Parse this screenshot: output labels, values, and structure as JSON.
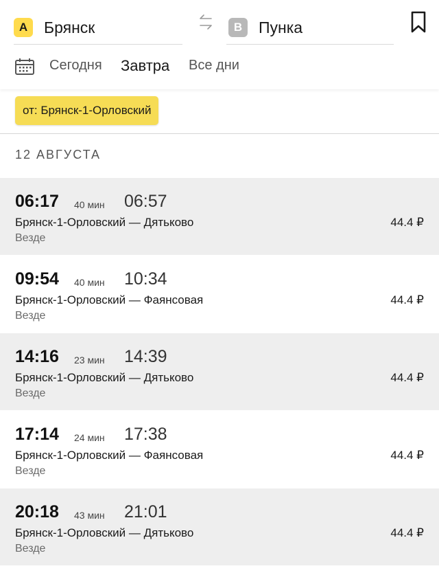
{
  "search": {
    "from": {
      "badge": "A",
      "city": "Брянск"
    },
    "to": {
      "badge": "B",
      "city": "Пунка"
    }
  },
  "days": {
    "today": "Сегодня",
    "tomorrow": "Завтра",
    "all": "Все дни",
    "selected": "tomorrow"
  },
  "station_filter": "от: Брянск-1-Орловский",
  "date_header": "12 АВГУСТА",
  "trips": [
    {
      "dep": "06:17",
      "duration": "40 мин",
      "arr": "06:57",
      "route": "Брянск-1-Орловский — Дятьково",
      "stops": "Везде",
      "price": "44.4 ₽"
    },
    {
      "dep": "09:54",
      "duration": "40 мин",
      "arr": "10:34",
      "route": "Брянск-1-Орловский — Фаянсовая",
      "stops": "Везде",
      "price": "44.4 ₽"
    },
    {
      "dep": "14:16",
      "duration": "23 мин",
      "arr": "14:39",
      "route": "Брянск-1-Орловский — Дятьково",
      "stops": "Везде",
      "price": "44.4 ₽"
    },
    {
      "dep": "17:14",
      "duration": "24 мин",
      "arr": "17:38",
      "route": "Брянск-1-Орловский — Фаянсовая",
      "stops": "Везде",
      "price": "44.4 ₽"
    },
    {
      "dep": "20:18",
      "duration": "43 мин",
      "arr": "21:01",
      "route": "Брянск-1-Орловский — Дятьково",
      "stops": "Везде",
      "price": "44.4 ₽"
    }
  ],
  "icons": {
    "swap": "swap-arrows-icon",
    "bookmark": "bookmark-icon",
    "calendar": "calendar-icon"
  },
  "colors": {
    "accent": "#ffdb4d",
    "chip": "#f6dc55",
    "shaded_row": "#eeeeee"
  }
}
